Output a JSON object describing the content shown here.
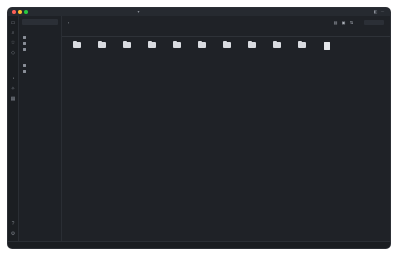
{
  "window": {
    "title": ""
  },
  "sidebar": {
    "vault_label": "",
    "sections": [
      {
        "label": "",
        "items": [
          "",
          "",
          ""
        ]
      },
      {
        "label": "",
        "items": [
          "",
          ""
        ]
      }
    ]
  },
  "toolbar": {
    "back": "",
    "path": "",
    "search_placeholder": ""
  },
  "columns": [
    "",
    "",
    ""
  ],
  "grid_items": [
    {
      "name": "",
      "kind": "folder"
    },
    {
      "name": "",
      "kind": "folder"
    },
    {
      "name": "",
      "kind": "folder"
    },
    {
      "name": "",
      "kind": "folder"
    },
    {
      "name": "",
      "kind": "folder"
    },
    {
      "name": "",
      "kind": "folder"
    },
    {
      "name": "",
      "kind": "folder"
    },
    {
      "name": "",
      "kind": "folder"
    },
    {
      "name": "",
      "kind": "folder"
    },
    {
      "name": "",
      "kind": "folder"
    },
    {
      "name": "",
      "kind": "file"
    }
  ],
  "status": {
    "left": "",
    "middle": "",
    "right": ""
  },
  "icons": {
    "rail": [
      "folder-icon",
      "search-icon",
      "star-icon",
      "tag-icon",
      "clock-icon",
      "settings-icon"
    ],
    "toolbar": [
      "new-file-icon",
      "new-folder-icon",
      "sort-icon",
      "view-icon"
    ]
  }
}
